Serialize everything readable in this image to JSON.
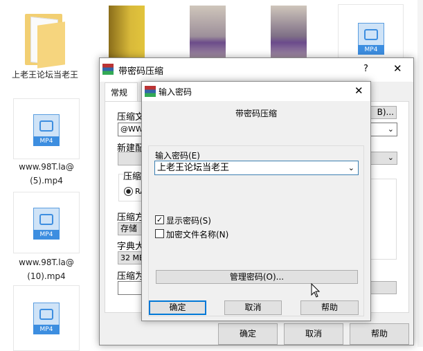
{
  "desktop": {
    "folder": {
      "label": "上老王论坛当老王"
    },
    "files": [
      {
        "icon_label": "MP4",
        "label": "www.98T.la@ (5).mp4",
        "line1": "www.98T.la@",
        "line2": "(5).mp4"
      },
      {
        "icon_label": "MP4",
        "label": "www.98T.la@ (10).mp4",
        "line1": "www.98T.la@",
        "line2": "(10).mp4"
      },
      {
        "icon_label": "MP4"
      },
      {
        "icon_label": "MP4"
      }
    ]
  },
  "back_dialog": {
    "title": "带密码压缩",
    "help": "?",
    "close": "✕",
    "tab": "常规",
    "labels": {
      "archive_name": "压缩文",
      "profile": "新建配",
      "format_group": "压缩",
      "format_radio": "RA",
      "method": "压缩方",
      "dict": "字典大",
      "split": "压缩为"
    },
    "values": {
      "archive_name": "@WW10.",
      "method": "存储",
      "dict": "32 MB"
    },
    "browse_button": "B)...",
    "buttons": {
      "ok": "确定",
      "cancel": "取消",
      "help": "帮助"
    }
  },
  "front_dialog": {
    "title": "输入密码",
    "close": "✕",
    "heading": "带密码压缩",
    "password_label": "输入密码(E)",
    "password_value": "上老王论坛当老王",
    "show_password": {
      "label": "显示密码(S)",
      "checked": true
    },
    "encrypt_names": {
      "label": "加密文件名称(N)",
      "checked": false
    },
    "manage_button": "管理密码(O)...",
    "buttons": {
      "ok": "确定",
      "cancel": "取消",
      "help": "帮助"
    }
  }
}
